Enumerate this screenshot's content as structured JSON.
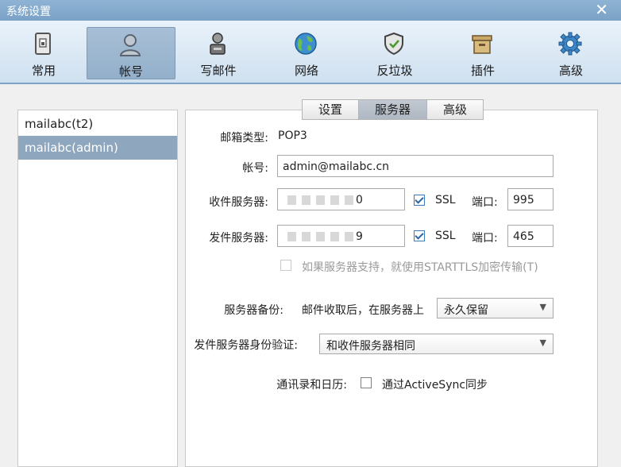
{
  "window": {
    "title": "系统设置",
    "close_glyph": "✕"
  },
  "toolbar": [
    {
      "label": "常用",
      "icon": "general-icon"
    },
    {
      "label": "帐号",
      "icon": "account-icon",
      "active": true
    },
    {
      "label": "写邮件",
      "icon": "compose-icon"
    },
    {
      "label": "网络",
      "icon": "network-icon"
    },
    {
      "label": "反垃圾",
      "icon": "antispam-icon"
    },
    {
      "label": "插件",
      "icon": "plugin-icon"
    },
    {
      "label": "高级",
      "icon": "advanced-icon"
    }
  ],
  "accounts": [
    {
      "name": "mailabc(t2)"
    },
    {
      "name": "mailabc(admin)",
      "selected": true
    }
  ],
  "tabs": [
    {
      "label": "设置"
    },
    {
      "label": "服务器",
      "active": true
    },
    {
      "label": "高级"
    }
  ],
  "form": {
    "mailbox_type_label": "邮箱类型:",
    "mailbox_type_value": "POP3",
    "account_label": "帐号:",
    "account_value": "admin@mailabc.cn",
    "incoming_label": "收件服务器:",
    "incoming_value": "0",
    "incoming_ssl": "SSL",
    "incoming_ssl_checked": true,
    "port_label": "端口:",
    "incoming_port": "995",
    "outgoing_label": "发件服务器:",
    "outgoing_value": "9",
    "outgoing_ssl": "SSL",
    "outgoing_ssl_checked": true,
    "outgoing_port": "465",
    "starttls_label": "如果服务器支持，就使用STARTTLS加密传输(T)",
    "backup_label": "服务器备份:",
    "backup_text": "邮件收取后，在服务器上",
    "backup_value": "永久保留",
    "auth_label": "发件服务器身份验证:",
    "auth_value": "和收件服务器相同",
    "sync_label": "通讯录和日历:",
    "sync_text": "通过ActiveSync同步"
  },
  "colors": {
    "titlebar": "#7aa2c6",
    "toolbar_active": "#93afca",
    "selected_account": "#8ea6be"
  }
}
